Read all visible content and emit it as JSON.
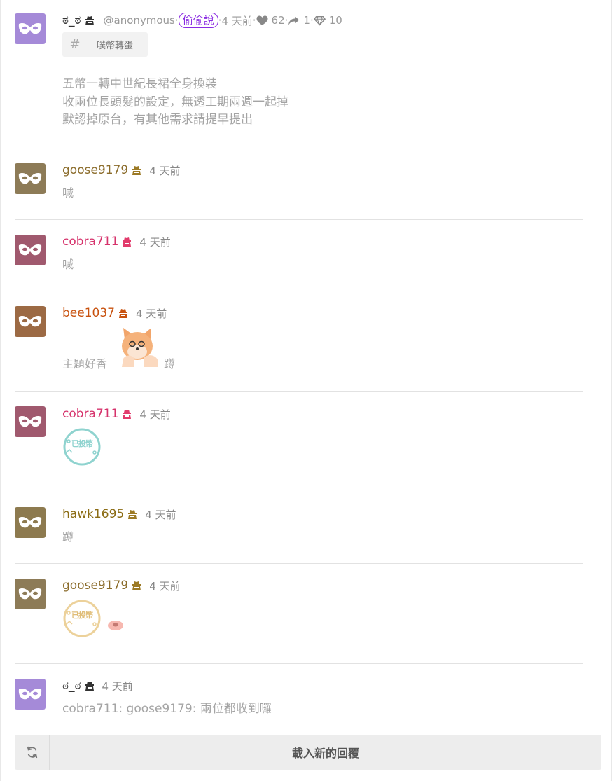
{
  "post": {
    "username": "ಠ_ಠ",
    "handle": "@anonymous",
    "board_badge": "偷偷說",
    "time": "4 天前",
    "likes": "62",
    "shares": "1",
    "diamonds": "10",
    "topic_tag": "噗幣轉蛋",
    "content_lines": [
      "五幣一轉中世紀長裙全身換裝",
      "收兩位長頭髮的設定，無透工期兩週一起掉",
      "默認掉原台，有其他需求請提早提出"
    ]
  },
  "replies": [
    {
      "username": "goose9179",
      "time": "4 天前",
      "text": "喊"
    },
    {
      "username": "cobra711",
      "time": "4 天前",
      "text": "喊"
    },
    {
      "username": "bee1037",
      "time": "4 天前",
      "text": "主題好香",
      "text_after": "蹲"
    },
    {
      "username": "cobra711",
      "time": "4 天前",
      "sticker_text": "已投幣"
    },
    {
      "username": "hawk1695",
      "time": "4 天前",
      "text": "蹲"
    },
    {
      "username": "goose9179",
      "time": "4 天前",
      "sticker_text": "已投幣"
    },
    {
      "username": "ಠ_ಠ",
      "time": "4 天前",
      "text": "cobra711: goose9179: 兩位都收到囉"
    }
  ],
  "load_more_label": "載入新的回覆",
  "colors": {
    "purple": "#a58ad8",
    "goose": "#8d7b57",
    "cobra": "#a0596e",
    "bee": "#9c6a44",
    "hawk": "#8d7a4f",
    "goose_name": "#8b6c2b",
    "cobra_name": "#d6336c",
    "bee_name": "#c8520f",
    "hawk_name": "#8b6c14"
  }
}
